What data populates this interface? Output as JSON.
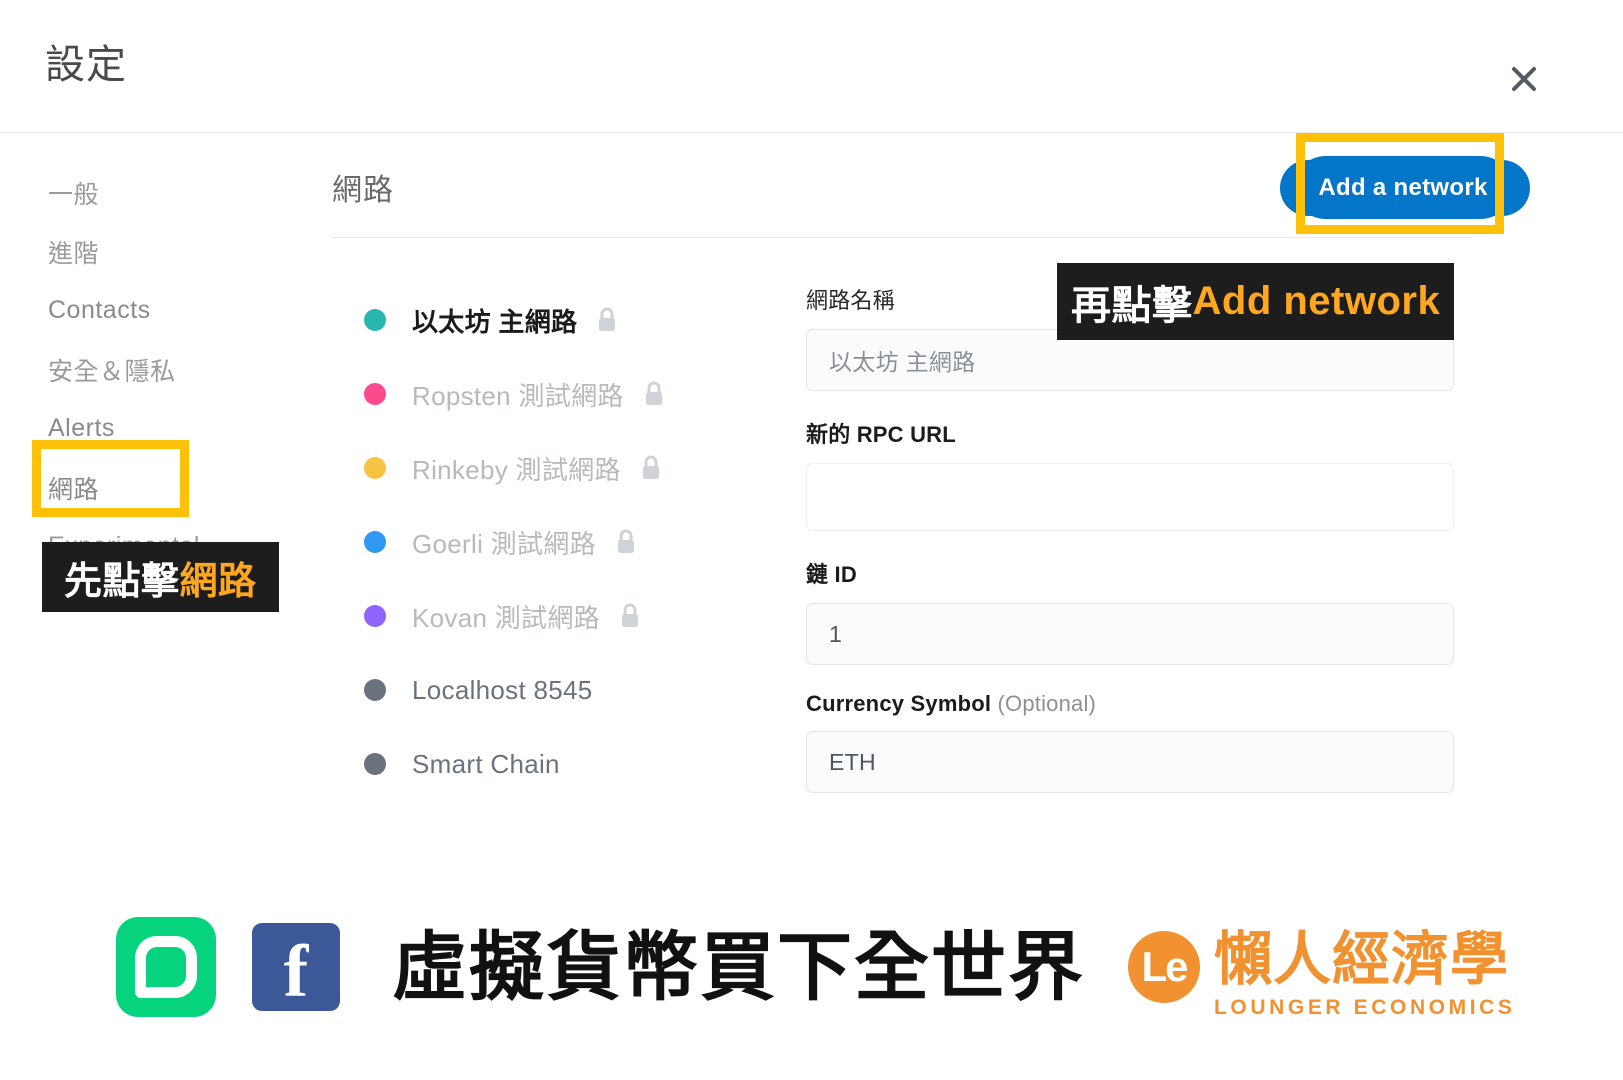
{
  "header": {
    "title": "設定",
    "close_icon": "close-icon"
  },
  "sidebar": {
    "items": [
      {
        "label": "一般"
      },
      {
        "label": "進階"
      },
      {
        "label": "Contacts"
      },
      {
        "label": "安全＆隱私"
      },
      {
        "label": "Alerts"
      },
      {
        "label": "網路"
      },
      {
        "label": "Experimental"
      }
    ]
  },
  "main": {
    "title": "網路",
    "add_network_label": "Add a network"
  },
  "networks": [
    {
      "label": "以太坊 主網路",
      "color": "#29b6af",
      "locked": true,
      "state": "active"
    },
    {
      "label": "Ropsten 測試網路",
      "color": "#ff4a8d",
      "locked": true,
      "state": "muted"
    },
    {
      "label": "Rinkeby 測試網路",
      "color": "#f6c343",
      "locked": true,
      "state": "muted"
    },
    {
      "label": "Goerli 測試網路",
      "color": "#3099f2",
      "locked": true,
      "state": "muted"
    },
    {
      "label": "Kovan 測試網路",
      "color": "#9064ff",
      "locked": true,
      "state": "muted"
    },
    {
      "label": "Localhost 8545",
      "color": "#6a737d",
      "locked": false,
      "state": "plain"
    },
    {
      "label": "Smart Chain",
      "color": "#6a737d",
      "locked": false,
      "state": "plain"
    }
  ],
  "form": {
    "network_name": {
      "label": "網路名稱",
      "value": "以太坊 主網路",
      "placeholder": "以太坊 主網路"
    },
    "rpc_url": {
      "label": "新的 RPC URL",
      "value": "",
      "placeholder": ""
    },
    "chain_id": {
      "label": "鏈 ID",
      "value": "1",
      "placeholder": "1"
    },
    "currency_symbol": {
      "label": "Currency Symbol",
      "optional_suffix": "(Optional)",
      "value": "ETH",
      "placeholder": "ETH"
    }
  },
  "callouts": {
    "sidebar": {
      "prefix": "先點擊",
      "highlight": "網路"
    },
    "button": {
      "prefix": "再點擊",
      "highlight": "Add network"
    }
  },
  "highlight_color": "#ffc107",
  "accent_color": "#0376c9",
  "banner": {
    "line_icon": "line-icon",
    "facebook_icon": "facebook-icon",
    "slogan": "虛擬貨幣買下全世界",
    "logo_mark": "Le",
    "logo_cn": "懶人經濟學",
    "logo_en": "LOUNGER ECONOMICS"
  }
}
